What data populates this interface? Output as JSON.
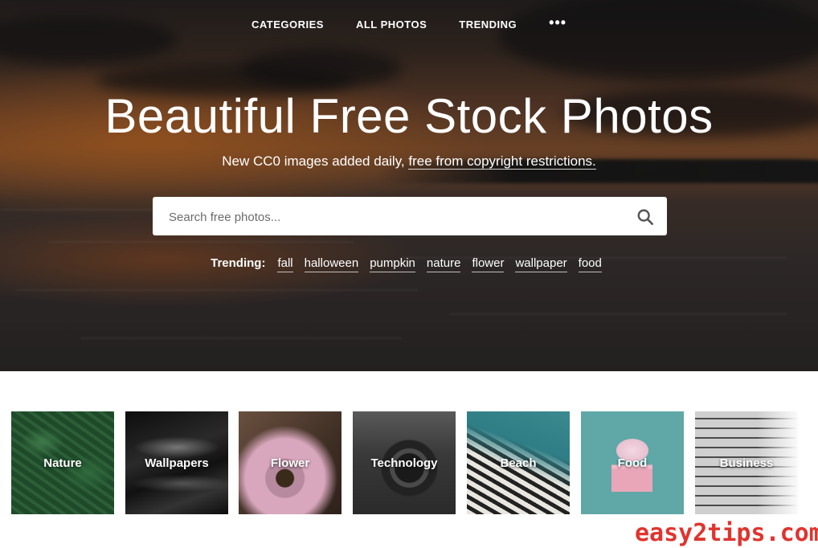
{
  "nav": {
    "items": [
      "CATEGORIES",
      "ALL PHOTOS",
      "TRENDING"
    ],
    "more": "•••"
  },
  "hero": {
    "title": "Beautiful Free Stock Photos",
    "subtitle_prefix": "New CC0 images added daily, ",
    "subtitle_link": "free from copyright restrictions."
  },
  "search": {
    "placeholder": "Search free photos...",
    "value": "",
    "icon": "search-icon"
  },
  "trending": {
    "label": "Trending:",
    "tags": [
      "fall",
      "halloween",
      "pumpkin",
      "nature",
      "flower",
      "wallpaper",
      "food"
    ]
  },
  "categories": [
    {
      "label": "Nature"
    },
    {
      "label": "Wallpapers"
    },
    {
      "label": "Flower"
    },
    {
      "label": "Technology"
    },
    {
      "label": "Beach"
    },
    {
      "label": "Food"
    },
    {
      "label": "Business"
    }
  ],
  "watermark": "easy2tips.com"
}
